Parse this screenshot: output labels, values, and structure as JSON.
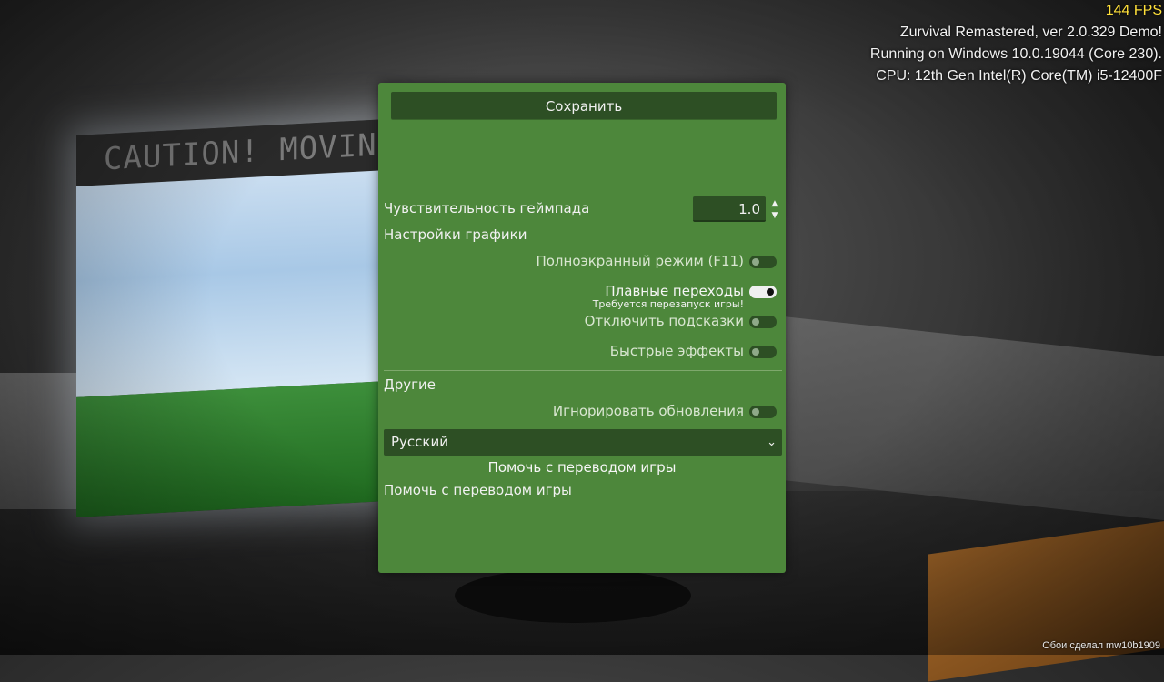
{
  "hud": {
    "fps": "144 FPS",
    "version": "Zurvival Remastered, ver 2.0.329 Demo!",
    "os": "Running on Windows 10.0.19044 (Core 230).",
    "cpu": "CPU: 12th Gen Intel(R) Core(TM) i5-12400F"
  },
  "scene": {
    "sign_text": "CAUTION!  MOVING"
  },
  "panel": {
    "save_label": "Сохранить",
    "gamepad_sensitivity": {
      "label": "Чувствительность геймпада",
      "value": "1.0"
    },
    "graphics_section": "Настройки графики",
    "options": [
      {
        "label": "Полноэкранный режим (F11)",
        "enabled": false
      },
      {
        "label": "Плавные переходы",
        "enabled": true,
        "note": "Требуется перезапуск игры!"
      },
      {
        "label": "Отключить подсказки",
        "enabled": false
      },
      {
        "label": "Быстрые эффекты",
        "enabled": false
      }
    ],
    "other_section": "Другие",
    "ignore_updates": {
      "label": "Игнорировать обновления",
      "enabled": false
    },
    "language": {
      "selected": "Русский"
    },
    "help_label": "Помочь с переводом игры",
    "help_link": "Помочь с переводом игры"
  },
  "credit": "Обои сделал mw10b1909",
  "colors": {
    "panel_bg": "#4d873b",
    "control_bg": "#2d4f24",
    "fps": "#ffe03a"
  }
}
